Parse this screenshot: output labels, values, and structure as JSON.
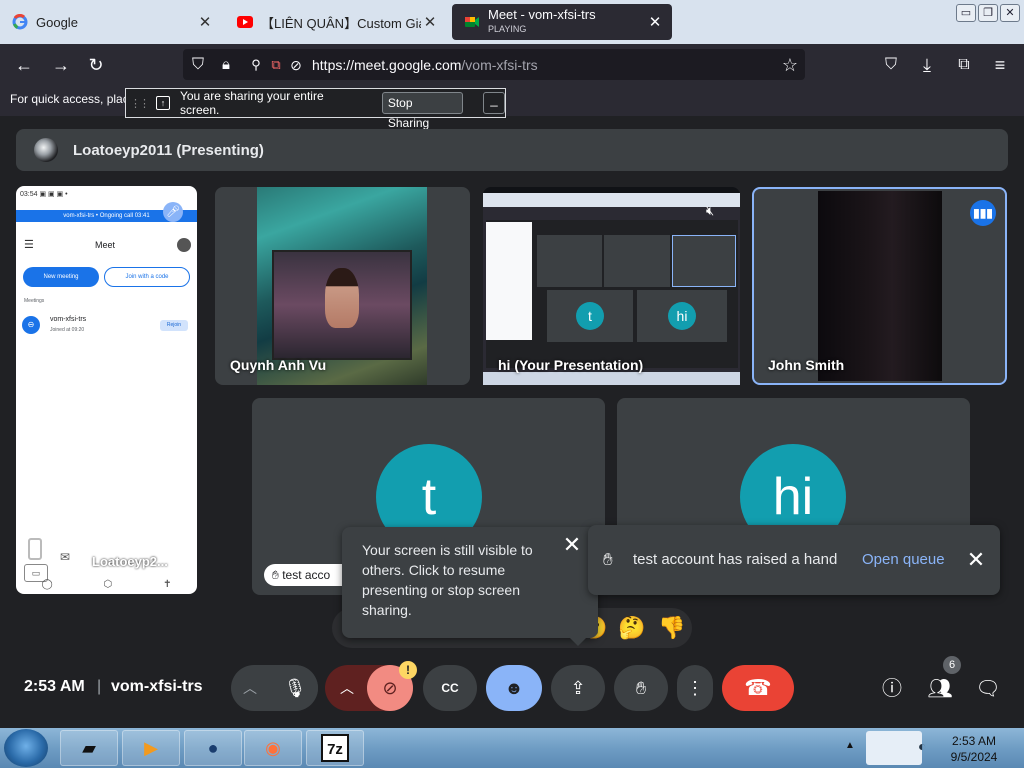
{
  "browser": {
    "tabs": [
      {
        "title": "Google"
      },
      {
        "title": "【LIÊN QUÂN】Custom Giao H"
      },
      {
        "title": "Meet - vom-xfsi-trs",
        "subtitle": "PLAYING"
      }
    ],
    "url_host": "https://meet.google.com",
    "url_path": "/vom-xfsi-trs",
    "window_buttons": {
      "minimize": "▭",
      "restore": "❐",
      "close": "✕"
    }
  },
  "bookmarks_hint": "For quick access, plac",
  "share_bar": {
    "message": "You are sharing your entire screen.",
    "stop_label": "Stop Sharing",
    "hide_label": "_"
  },
  "presenter": {
    "name": "Loatoeyp2011 (Presenting)"
  },
  "tiles": {
    "phone": {
      "status": "03:54 ▣ ▣ ▣ •",
      "banner": "vom-xfsi-trs • Ongoing call 03:41",
      "app_title": "Meet",
      "new_meeting": "New meeting",
      "join_code": "Join with a code",
      "meetings_label": "Meetings",
      "meeting_code": "vom-xfsi-trs",
      "joined": "Joined at 09:20",
      "rejoin": "Rejoin",
      "name": "Loatoeyp2..."
    },
    "quynh": {
      "name": "Quynh Anh Vu"
    },
    "presentation": {
      "name": "hi (Your Presentation)",
      "inner_initial_1": "t",
      "inner_initial_2": "hi"
    },
    "john": {
      "name": "John Smith"
    },
    "t_tile": {
      "initial": "t",
      "hand_chip": "test acco"
    },
    "hi_tile": {
      "initial": "hi"
    }
  },
  "tooltip": {
    "text": "Your screen is still visible to others. Click to resume presenting or stop screen sharing.",
    "close": "✕"
  },
  "toast": {
    "text": "test account has raised a hand",
    "action": "Open queue",
    "close": "✕"
  },
  "reactions": [
    "😮",
    "🤔",
    "👎"
  ],
  "controls": {
    "time": "2:53 AM",
    "separator": "|",
    "meeting_code": "vom-xfsi-trs",
    "camera_warning": "!",
    "people_count": "6"
  },
  "taskbar": {
    "time": "2:53 AM",
    "date": "9/5/2024",
    "apps": [
      "7z"
    ]
  },
  "colors": {
    "meet_bg": "#202124",
    "tile_bg": "#3c4043",
    "accent_blue": "#8ab4f8",
    "avatar_teal": "#129eaf",
    "end_call_red": "#ea4335",
    "cam_off_red": "#5f2120"
  }
}
